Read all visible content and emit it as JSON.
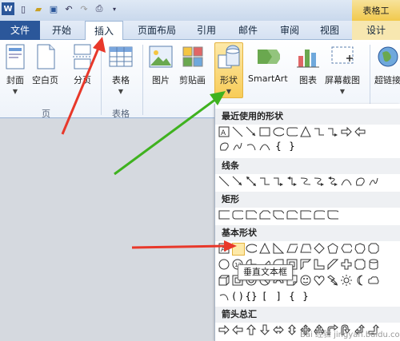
{
  "context_tab_title": "表格工",
  "tabs": [
    "文件",
    "开始",
    "插入",
    "页面布局",
    "引用",
    "邮件",
    "审阅",
    "视图",
    "设计"
  ],
  "ribbon": {
    "pages_group": {
      "label": "页",
      "buttons": [
        "封面",
        "空白页",
        "分页"
      ]
    },
    "table_group": {
      "label": "表格",
      "buttons": [
        "表格"
      ]
    },
    "illus_buttons": [
      "图片",
      "剪贴画",
      "形状",
      "SmartArt",
      "图表",
      "屏幕截图",
      "超链接"
    ]
  },
  "shapes_panel": {
    "sections": [
      "最近使用的形状",
      "线条",
      "矩形",
      "基本形状",
      "箭头总汇"
    ]
  },
  "tooltip": "垂直文本框",
  "colors": {
    "accent": "#2b579a",
    "highlight": "#f8cc58",
    "red_arrow": "#e8382a",
    "green_arrow": "#3fb21f"
  },
  "watermark": "Bai 经验 jingyan.baidu.com"
}
